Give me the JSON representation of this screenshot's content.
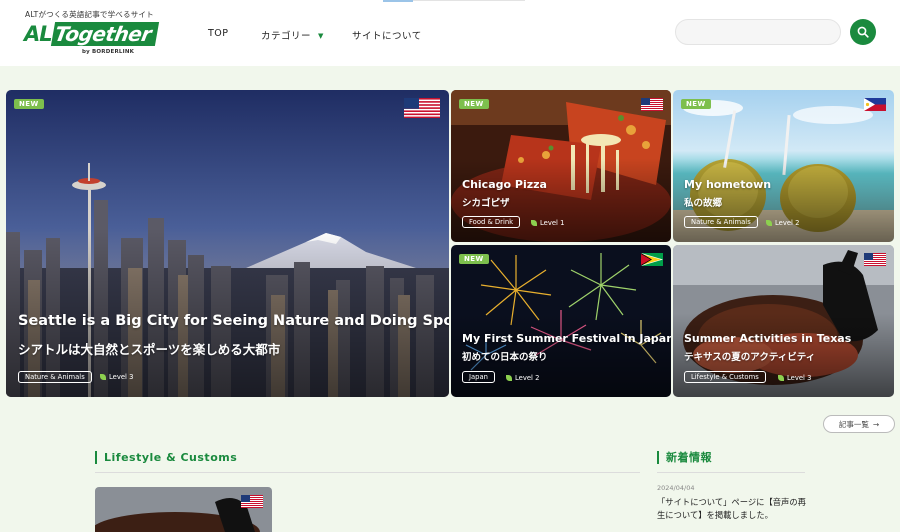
{
  "header": {
    "tagline": "ALTがつくる英語記事で学べるサイト",
    "logo_al": "AL",
    "logo_rest": "Together",
    "logo_by": "by BORDERLINK",
    "nav": [
      {
        "label": "TOP"
      },
      {
        "label": "カテゴリー"
      },
      {
        "label": "サイトについて"
      }
    ],
    "search_placeholder": ""
  },
  "cards": [
    {
      "title_en": "Seattle is a Big City for Seeing Nature and Doing Sports",
      "title_jp": "シアトルは大自然とスポーツを楽しめる大都市",
      "category": "Nature & Animals",
      "level": "Level 3",
      "badge": "NEW",
      "flag": "us-flag"
    },
    {
      "title_en": "Chicago Pizza",
      "title_jp": "シカゴピザ",
      "category": "Food & Drink",
      "level": "Level 1",
      "badge": "NEW",
      "flag": "us-flag"
    },
    {
      "title_en": "My hometown",
      "title_jp": "私の故郷",
      "category": "Nature & Animals",
      "level": "Level 2",
      "badge": "NEW",
      "flag": "philippines-flag"
    },
    {
      "title_en": "My First Summer Festival in Japan",
      "title_jp": "初めての日本の祭り",
      "category": "Japan",
      "level": "Level 2",
      "badge": "NEW",
      "flag": "guyana-flag"
    },
    {
      "title_en": "Summer Activities in Texas",
      "title_jp": "テキサスの夏のアクティビティ",
      "category": "Lifestyle & Customs",
      "level": "Level 3",
      "badge": "",
      "flag": "us-flag"
    }
  ],
  "more_button": "記事一覧",
  "sections": {
    "lifestyle_title": "Lifestyle & Customs",
    "news_title": "新着情報"
  },
  "news": [
    {
      "date": "2024/04/04",
      "text": "「サイトについて」ページに【音声の再生について】を掲載しました。"
    }
  ],
  "colors": {
    "brand": "#1a8a3e",
    "new_badge": "#7dbf4d",
    "background": "#f1f7ec"
  }
}
